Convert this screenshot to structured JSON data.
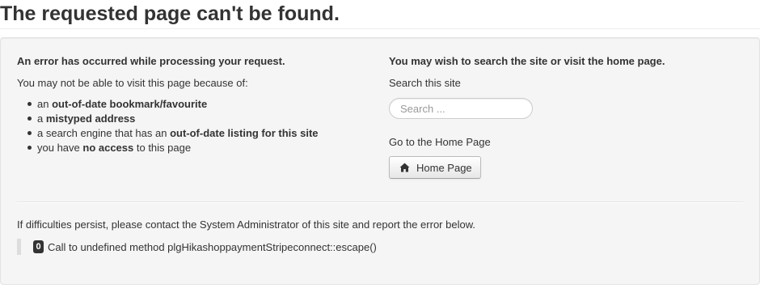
{
  "page": {
    "title": "The requested page can't be found."
  },
  "error_panel": {
    "heading": "An error has occurred while processing your request.",
    "reasons_intro": "You may not be able to visit this page because of:",
    "reasons": [
      {
        "before": "an ",
        "bold": "out-of-date bookmark/favourite",
        "after": ""
      },
      {
        "before": "a ",
        "bold": "mistyped address",
        "after": ""
      },
      {
        "before": "a search engine that has an ",
        "bold": "out-of-date listing for this site",
        "after": ""
      },
      {
        "before": "you have ",
        "bold": "no access",
        "after": " to this page"
      }
    ]
  },
  "search_panel": {
    "heading": "You may wish to search the site or visit the home page.",
    "search_label": "Search this site",
    "search_placeholder": "Search ...",
    "search_value": "",
    "home_label": "Go to the Home Page",
    "home_button_label": "Home Page",
    "home_button_icon": "home-icon"
  },
  "footer": {
    "contact_text": "If difficulties persist, please contact the System Administrator of this site and report the error below.",
    "error_code": "0",
    "error_message": "Call to undefined method plgHikashoppaymentStripeconnect::escape()"
  },
  "colors": {
    "panel_background": "#f5f5f5",
    "panel_border": "#e3e3e3",
    "text": "#333333",
    "badge_background": "#333333",
    "quote_border": "#dddddd"
  }
}
